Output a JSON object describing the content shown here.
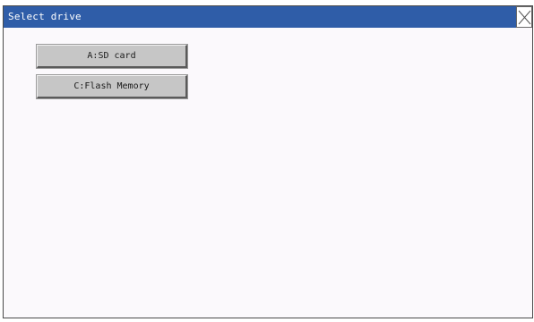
{
  "window": {
    "title": "Select drive"
  },
  "drives": [
    {
      "label": "A:SD card"
    },
    {
      "label": "C:Flash Memory"
    }
  ],
  "colors": {
    "titlebar": "#2f5da8",
    "button_face": "#c6c6c6",
    "background": "#fbf9fc"
  },
  "icons": {
    "close": "close-icon"
  }
}
